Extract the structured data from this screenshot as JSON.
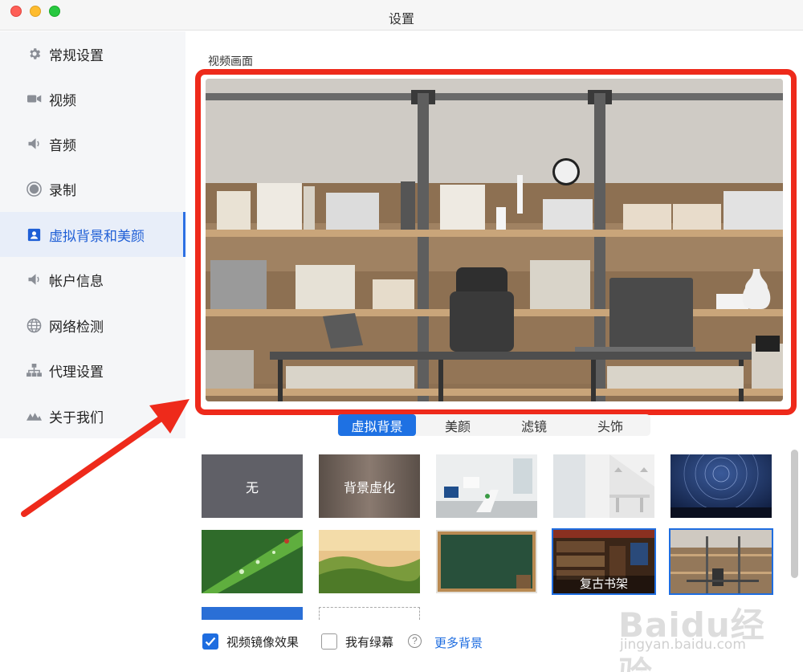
{
  "window": {
    "title": "设置"
  },
  "sidebar": {
    "items": [
      {
        "label": "常规设置",
        "icon": "gear-icon"
      },
      {
        "label": "视频",
        "icon": "video-camera-icon"
      },
      {
        "label": "音频",
        "icon": "speaker-icon"
      },
      {
        "label": "录制",
        "icon": "record-icon"
      },
      {
        "label": "虚拟背景和美颜",
        "icon": "person-card-icon",
        "active": true
      },
      {
        "label": "帐户信息",
        "icon": "speaker-icon"
      },
      {
        "label": "网络检测",
        "icon": "globe-icon"
      },
      {
        "label": "代理设置",
        "icon": "network-tree-icon"
      },
      {
        "label": "关于我们",
        "icon": "logo-icon"
      }
    ]
  },
  "main": {
    "section_label": "视频画面",
    "tabs": [
      {
        "label": "虚拟背景",
        "active": true
      },
      {
        "label": "美颜"
      },
      {
        "label": "滤镜"
      },
      {
        "label": "头饰"
      }
    ],
    "backgrounds": [
      {
        "label": "无"
      },
      {
        "label": "背景虚化"
      },
      {
        "label": ""
      },
      {
        "label": ""
      },
      {
        "label": ""
      },
      {
        "label": ""
      },
      {
        "label": ""
      },
      {
        "label": ""
      },
      {
        "label": "复古书架"
      },
      {
        "label": ""
      }
    ],
    "options": {
      "mirror_label": "视频镜像效果",
      "mirror_checked": true,
      "greenscreen_label": "我有绿幕",
      "greenscreen_checked": false,
      "help_glyph": "?",
      "more_link": "更多背景"
    }
  },
  "watermark": {
    "brand": "Baidu经验",
    "url": "jingyan.baidu.com"
  },
  "colors": {
    "accent": "#1e6de0",
    "highlight": "#ee2a1b",
    "sidebar_bg": "#f5f6f8"
  }
}
